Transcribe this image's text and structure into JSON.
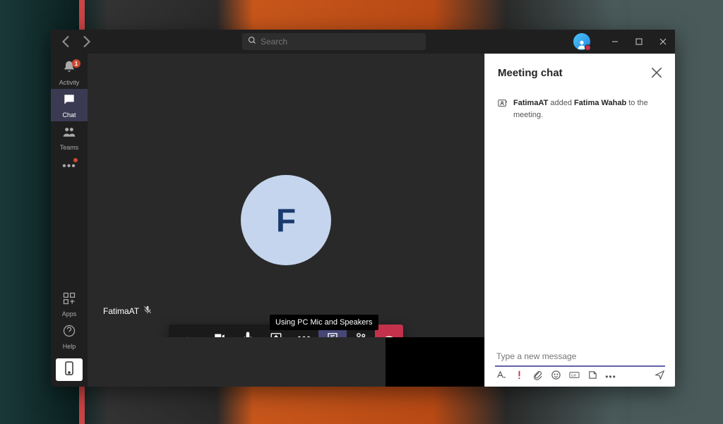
{
  "titlebar": {
    "search_placeholder": "Search"
  },
  "rail": {
    "items": [
      {
        "label": "Activity",
        "badge": "1"
      },
      {
        "label": "Chat"
      },
      {
        "label": "Teams"
      }
    ],
    "apps_label": "Apps",
    "help_label": "Help"
  },
  "stage": {
    "participant_name": "FatimaAT",
    "avatar_initial": "F",
    "tooltip_text": "Using PC Mic and Speakers",
    "duration": "--:--"
  },
  "chat": {
    "title": "Meeting chat",
    "sys_actor": "FatimaAT",
    "sys_verb": " added ",
    "sys_target": "Fatima Wahab",
    "sys_tail": " to the meeting.",
    "compose_placeholder": "Type a new message"
  }
}
